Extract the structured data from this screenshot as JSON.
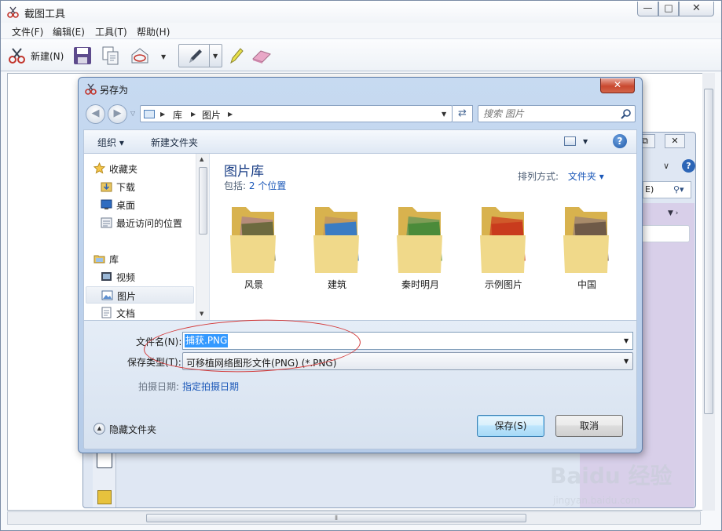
{
  "main_window": {
    "title": "截图工具",
    "caption": {
      "minimize": "—",
      "maximize": "□",
      "close": "✕"
    },
    "menu": [
      "文件(F)",
      "编辑(E)",
      "工具(T)",
      "帮助(H)"
    ],
    "toolbar": {
      "new_label": "新建(N)"
    }
  },
  "background_window": {
    "restore_icon": "⧉",
    "close_icon": "✕",
    "text_fragment": "E)"
  },
  "dialog": {
    "title": "另存为",
    "close_label": "✕",
    "address": {
      "root": "库",
      "current": "图片"
    },
    "search_placeholder": "搜索 图片",
    "commands": {
      "organize": "组织 ▾",
      "new_folder": "新建文件夹",
      "help": "?"
    },
    "nav": {
      "favorites": "收藏夹",
      "downloads": "下载",
      "desktop": "桌面",
      "recent": "最近访问的位置",
      "libraries": "库",
      "videos": "视频",
      "pictures": "图片",
      "documents": "文档"
    },
    "library": {
      "title": "图片库",
      "includes_label": "包括:",
      "includes_link": "2 个位置",
      "arrange_label": "排列方式:",
      "arrange_value": "文件夹 ▾"
    },
    "folders": [
      {
        "name": "风景"
      },
      {
        "name": "建筑"
      },
      {
        "name": "秦时明月"
      },
      {
        "name": "示例图片"
      },
      {
        "name": "中国"
      }
    ],
    "filename_label": "文件名(N):",
    "filename_value": "捕获.PNG",
    "filetype_label": "保存类型(T):",
    "filetype_value": "可移植网络图形文件(PNG) (*.PNG)",
    "date_label": "拍摄日期:",
    "date_link": "指定拍摄日期",
    "hide_folders": "隐藏文件夹",
    "save_button": "保存(S)",
    "cancel_button": "取消"
  },
  "watermark": {
    "logo": "Baidu 经验",
    "url": "jingyan.baidu.com"
  },
  "colors": {
    "accent_link": "#1a57b8",
    "library_title": "#1b3f86",
    "selection": "#3399ff",
    "annotation_red": "#d43b3b"
  }
}
